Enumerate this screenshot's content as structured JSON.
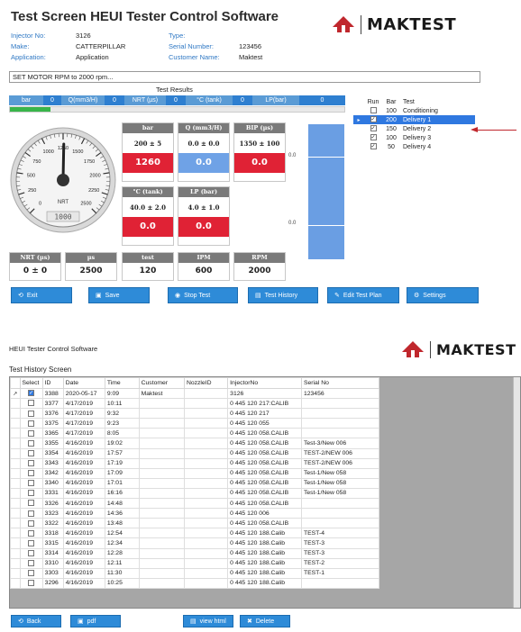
{
  "app": {
    "title": "Test Screen HEUI Tester Control Software",
    "logo_text": "MAKTEST"
  },
  "info": {
    "injector_no_label": "Injector No:",
    "injector_no": "3126",
    "make_label": "Make:",
    "make": "CATTERPILLAR",
    "application_label": "Application:",
    "application": "Application",
    "type_label": "Type:",
    "type": "",
    "serial_label": "Serial Number:",
    "serial": "123456",
    "customer_label": "Customer Name:",
    "customer": "Maktest"
  },
  "command": "SET MOTOR RPM to 2000 rpm...",
  "results": {
    "label": "Test Results",
    "bar_cells": [
      {
        "label": "bar",
        "value": "0"
      },
      {
        "label": "Q(mm3/H)",
        "value": "0"
      },
      {
        "label": "NRT (µs)",
        "value": "0"
      },
      {
        "label": "°C (tank)",
        "value": "0"
      },
      {
        "label": "LP(bar)",
        "value": "0"
      }
    ],
    "progress_fraction": 0.12
  },
  "gauge": {
    "ticks": [
      "0",
      "250",
      "500",
      "750",
      "1000",
      "1250",
      "1500",
      "1750",
      "2000",
      "2250",
      "2500"
    ],
    "unit": "NRT",
    "readout": "1000",
    "value": 1260,
    "max": 2500
  },
  "panels": [
    {
      "head": "bar",
      "spec": "200 ± 5",
      "value": "1260",
      "color": "#e02235"
    },
    {
      "head": "Q (mm3/H)",
      "spec": "0.0 ± 0.0",
      "value": "0.0",
      "color": "#6fa2e6"
    },
    {
      "head": "BIP (µs)",
      "spec": "1350 ± 100",
      "value": "0.0",
      "color": "#e02235"
    },
    {
      "head": "°C (tank)",
      "spec": "40.0 ± 2.0",
      "value": "0.0",
      "color": "#e02235"
    },
    {
      "head": "LP (bar)",
      "spec": "4.0 ± 1.0",
      "value": "0.0",
      "color": "#e02235"
    }
  ],
  "small_panels": [
    {
      "head": "NRT (µs)",
      "value": "0 ± 0"
    },
    {
      "head": "µs",
      "value": "2500"
    },
    {
      "head": "test",
      "value": "120"
    },
    {
      "head": "IPM",
      "value": "600"
    },
    {
      "head": "RPM",
      "value": "2000"
    }
  ],
  "bar_ticks": [
    "0.0",
    "0.0"
  ],
  "run_table": {
    "headers": {
      "run": "Run",
      "bar": "Bar",
      "test": "Test"
    },
    "rows": [
      {
        "checked": false,
        "bar": "100",
        "test": "Conditioning",
        "selected": false
      },
      {
        "checked": true,
        "bar": "200",
        "test": "Delivery 1",
        "selected": true
      },
      {
        "checked": true,
        "bar": "150",
        "test": "Delivery 2",
        "selected": false
      },
      {
        "checked": true,
        "bar": "100",
        "test": "Delivery 3",
        "selected": false
      },
      {
        "checked": true,
        "bar": "50",
        "test": "Delivery 4",
        "selected": false
      }
    ]
  },
  "buttons": {
    "exit": "Exit",
    "save": "Save",
    "stop": "Stop Test",
    "history": "Test History",
    "edit_plan": "Edit Test Plan",
    "settings": "Settings"
  },
  "history": {
    "window_title": "HEUI Tester Control Software",
    "screen_title": "Test History Screen",
    "columns": [
      "Select",
      "ID",
      "Date",
      "Time",
      "Customer",
      "NozzleID",
      "InjectorNo",
      "Serial No"
    ],
    "rows": [
      {
        "sel": true,
        "id": "3388",
        "date": "2020-05-17",
        "time": "9:09",
        "customer": "Maktest",
        "nozzle": "",
        "injector": "3126",
        "serial": "123456"
      },
      {
        "sel": false,
        "id": "3377",
        "date": "4/17/2019",
        "time": "10:11",
        "customer": "",
        "nozzle": "",
        "injector": "0 445 120 217:CALIB",
        "serial": ""
      },
      {
        "sel": false,
        "id": "3376",
        "date": "4/17/2019",
        "time": "9:32",
        "customer": "",
        "nozzle": "",
        "injector": "0 445 120 217",
        "serial": ""
      },
      {
        "sel": false,
        "id": "3375",
        "date": "4/17/2019",
        "time": "9:23",
        "customer": "",
        "nozzle": "",
        "injector": "0 445 120 055",
        "serial": ""
      },
      {
        "sel": false,
        "id": "3365",
        "date": "4/17/2019",
        "time": "8:05",
        "customer": "",
        "nozzle": "",
        "injector": "0 445 120 058.CALIB",
        "serial": ""
      },
      {
        "sel": false,
        "id": "3355",
        "date": "4/16/2019",
        "time": "19:02",
        "customer": "",
        "nozzle": "",
        "injector": "0 445 120 058.CALIB",
        "serial": "Test-3/New 006"
      },
      {
        "sel": false,
        "id": "3354",
        "date": "4/16/2019",
        "time": "17:57",
        "customer": "",
        "nozzle": "",
        "injector": "0 445 120 058.CALIB",
        "serial": "TEST-2/NEW 006"
      },
      {
        "sel": false,
        "id": "3343",
        "date": "4/16/2019",
        "time": "17:19",
        "customer": "",
        "nozzle": "",
        "injector": "0 445 120 058.CALIB",
        "serial": "TEST-2/NEW 006"
      },
      {
        "sel": false,
        "id": "3342",
        "date": "4/16/2019",
        "time": "17:09",
        "customer": "",
        "nozzle": "",
        "injector": "0 445 120 058.CALIB",
        "serial": "Test-1/New 058"
      },
      {
        "sel": false,
        "id": "3340",
        "date": "4/16/2019",
        "time": "17:01",
        "customer": "",
        "nozzle": "",
        "injector": "0 445 120 058.CALIB",
        "serial": "Test-1/New 058"
      },
      {
        "sel": false,
        "id": "3331",
        "date": "4/16/2019",
        "time": "16:16",
        "customer": "",
        "nozzle": "",
        "injector": "0 445 120 058.CALIB",
        "serial": "Test-1/New 058"
      },
      {
        "sel": false,
        "id": "3326",
        "date": "4/16/2019",
        "time": "14:48",
        "customer": "",
        "nozzle": "",
        "injector": "0 445 120 058.CALIB",
        "serial": ""
      },
      {
        "sel": false,
        "id": "3323",
        "date": "4/16/2019",
        "time": "14:36",
        "customer": "",
        "nozzle": "",
        "injector": "0 445 120 006",
        "serial": ""
      },
      {
        "sel": false,
        "id": "3322",
        "date": "4/16/2019",
        "time": "13:48",
        "customer": "",
        "nozzle": "",
        "injector": "0 445 120 058.CALIB",
        "serial": ""
      },
      {
        "sel": false,
        "id": "3318",
        "date": "4/16/2019",
        "time": "12:54",
        "customer": "",
        "nozzle": "",
        "injector": "0 445 120 188.Calib",
        "serial": "TEST-4"
      },
      {
        "sel": false,
        "id": "3315",
        "date": "4/16/2019",
        "time": "12:34",
        "customer": "",
        "nozzle": "",
        "injector": "0 445 120 188.Calib",
        "serial": "TEST-3"
      },
      {
        "sel": false,
        "id": "3314",
        "date": "4/16/2019",
        "time": "12:28",
        "customer": "",
        "nozzle": "",
        "injector": "0 445 120 188.Calib",
        "serial": "TEST-3"
      },
      {
        "sel": false,
        "id": "3310",
        "date": "4/16/2019",
        "time": "12:11",
        "customer": "",
        "nozzle": "",
        "injector": "0 445 120 188.Calib",
        "serial": "TEST-2"
      },
      {
        "sel": false,
        "id": "3303",
        "date": "4/16/2019",
        "time": "11:30",
        "customer": "",
        "nozzle": "",
        "injector": "0 445 120 188.Calib",
        "serial": "TEST-1"
      },
      {
        "sel": false,
        "id": "3296",
        "date": "4/16/2019",
        "time": "10:25",
        "customer": "",
        "nozzle": "",
        "injector": "0 445 120 188.Calib",
        "serial": ""
      }
    ],
    "buttons": {
      "back": "Back",
      "pdf": "pdf",
      "view_html": "view html",
      "delete": "Delete"
    }
  }
}
